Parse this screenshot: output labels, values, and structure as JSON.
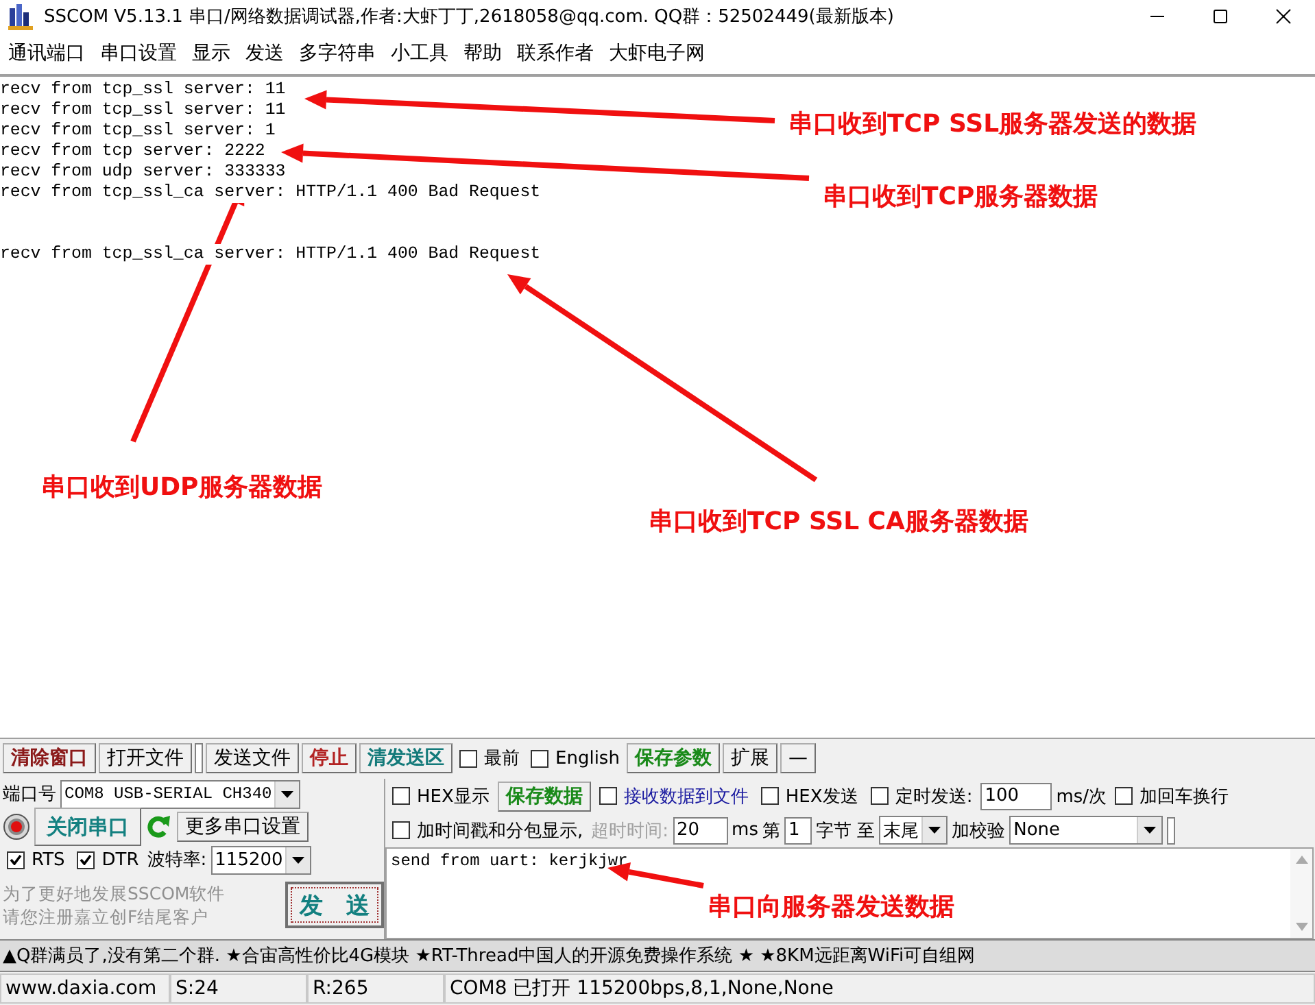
{
  "window": {
    "title": "SSCOM V5.13.1 串口/网络数据调试器,作者:大虾丁丁,2618058@qq.com. QQ群：52502449(最新版本)"
  },
  "menu": [
    "通讯端口",
    "串口设置",
    "显示",
    "发送",
    "多字符串",
    "小工具",
    "帮助",
    "联系作者",
    "大虾电子网"
  ],
  "receive_blocks": [
    {
      "lines": [
        "recv from tcp_ssl server: 11",
        "recv from tcp_ssl server: 11",
        "recv from tcp_ssl server: 1",
        "recv from tcp server: 2222",
        "recv from udp server: 333333",
        "recv from tcp_ssl_ca server: HTTP/1.1 400 Bad Request"
      ]
    },
    {
      "lines": [
        "recv from tcp_ssl_ca server: HTTP/1.1 400 Bad Request"
      ]
    }
  ],
  "annotations": [
    {
      "text": "串口收到TCP SSL服务器发送的数据"
    },
    {
      "text": "串口收到TCP服务器数据"
    },
    {
      "text": "串口收到UDP服务器数据"
    },
    {
      "text": "串口收到TCP SSL CA服务器数据"
    },
    {
      "text": "串口向服务器发送数据"
    }
  ],
  "toolbar": [
    {
      "kind": "button",
      "label": "清除窗口",
      "color": "#8b1a1a"
    },
    {
      "kind": "button",
      "label": "打开文件"
    },
    {
      "kind": "field"
    },
    {
      "kind": "button",
      "label": "发送文件"
    },
    {
      "kind": "button",
      "label": "停止",
      "color": "#b22222"
    },
    {
      "kind": "button",
      "label": "清发送区",
      "color": "#137a7a"
    },
    {
      "kind": "checkbox",
      "label": "最前",
      "checked": false
    },
    {
      "kind": "checkbox",
      "label": "English",
      "checked": false
    },
    {
      "kind": "button",
      "label": "保存参数",
      "color": "#1a8a1a"
    },
    {
      "kind": "button",
      "label": "扩展"
    },
    {
      "kind": "button",
      "label": "—"
    }
  ],
  "port_panel": {
    "port_label": "端口号",
    "port": "COM8 USB-SERIAL CH340",
    "close_button": "关闭串口",
    "more_button": "更多串口设置",
    "rts": {
      "label": "RTS",
      "checked": true
    },
    "dtr": {
      "label": "DTR",
      "checked": true
    },
    "baud_label": "波特率:",
    "baud": "115200",
    "promo": [
      "为了更好地发展SSCOM软件",
      "请您注册嘉立创F结尾客户"
    ],
    "send_button": "发　送"
  },
  "options_row_1": [
    {
      "kind": "checkbox",
      "label": "HEX显示",
      "checked": false
    },
    {
      "kind": "button",
      "label": "保存数据",
      "color": "#1a8a1a"
    },
    {
      "kind": "checkbox",
      "label": "接收数据到文件",
      "checked": false,
      "color": "#1a1aa0"
    },
    {
      "kind": "checkbox",
      "label": "HEX发送",
      "checked": false
    },
    {
      "kind": "checkbox",
      "label": "定时发送:",
      "checked": false
    },
    {
      "kind": "field",
      "value": "100"
    },
    {
      "kind": "label",
      "text": "ms/次",
      "disabled": false
    },
    {
      "kind": "checkbox",
      "label": "加回车换行",
      "checked": false
    }
  ],
  "options_row_2": [
    {
      "kind": "checkbox",
      "label": "加时间戳和分包显示,",
      "checked": false
    },
    {
      "kind": "label",
      "text": "超时时间:",
      "disabled": true
    },
    {
      "kind": "field",
      "value": "20"
    },
    {
      "kind": "label",
      "text": "ms",
      "disabled": false
    },
    {
      "kind": "label",
      "text": "第",
      "disabled": false
    },
    {
      "kind": "field",
      "value": "1"
    },
    {
      "kind": "label",
      "text": "字节 至",
      "disabled": false
    },
    {
      "kind": "combo",
      "value": "末尾"
    },
    {
      "kind": "label",
      "text": "加校验",
      "disabled": false
    },
    {
      "kind": "combo",
      "value": "None"
    },
    {
      "kind": "field"
    }
  ],
  "send_text": "send from uart: kerjkjwr",
  "ad_bar": "▲Q群满员了,没有第二个群. ★合宙高性价比4G模块 ★RT-Thread中国人的开源免费操作系统 ★ ★8KM远距离WiFi可自组网",
  "status_bar": [
    "www.daxia.com",
    "S:24",
    "R:265",
    "COM8 已打开  115200bps,8,1,None,None"
  ]
}
